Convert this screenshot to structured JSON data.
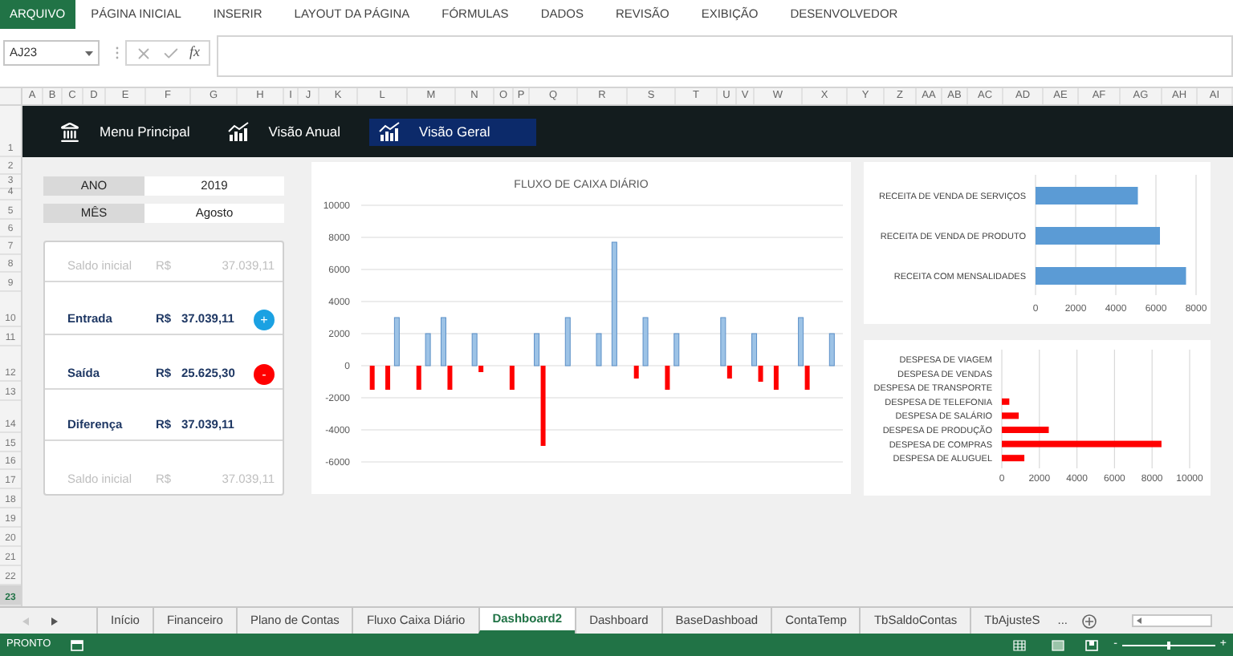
{
  "ribbon_tabs": [
    {
      "label": "ARQUIVO",
      "selected": true
    },
    {
      "label": "PÁGINA INICIAL",
      "selected": false
    },
    {
      "label": "INSERIR",
      "selected": false
    },
    {
      "label": "LAYOUT DA PÁGINA",
      "selected": false
    },
    {
      "label": "FÓRMULAS",
      "selected": false
    },
    {
      "label": "DADOS",
      "selected": false
    },
    {
      "label": "REVISÃO",
      "selected": false
    },
    {
      "label": "EXIBIÇÃO",
      "selected": false
    },
    {
      "label": "DESENVOLVEDOR",
      "selected": false
    }
  ],
  "name_box": {
    "value": "AJ23"
  },
  "formula_bar": {
    "fx_label": "fx"
  },
  "column_headers": [
    "A",
    "B",
    "C",
    "D",
    "E",
    "F",
    "G",
    "H",
    "I",
    "J",
    "K",
    "L",
    "M",
    "N",
    "O",
    "P",
    "Q",
    "R",
    "S",
    "T",
    "U",
    "V",
    "W",
    "X",
    "Y",
    "Z",
    "AA",
    "AB",
    "AC",
    "AD",
    "AE",
    "AF",
    "AG",
    "AH",
    "AI"
  ],
  "row_headers": [
    {
      "label": "1",
      "selected": false
    },
    {
      "label": "2",
      "selected": false
    },
    {
      "label": "3",
      "selected": false
    },
    {
      "label": "4",
      "selected": false
    },
    {
      "label": "5",
      "selected": false
    },
    {
      "label": "6",
      "selected": false
    },
    {
      "label": "7",
      "selected": false
    },
    {
      "label": "8",
      "selected": false
    },
    {
      "label": "9",
      "selected": false
    },
    {
      "label": "10",
      "selected": false
    },
    {
      "label": "11",
      "selected": false
    },
    {
      "label": "12",
      "selected": false
    },
    {
      "label": "13",
      "selected": false
    },
    {
      "label": "14",
      "selected": false
    },
    {
      "label": "15",
      "selected": false
    },
    {
      "label": "16",
      "selected": false
    },
    {
      "label": "17",
      "selected": false
    },
    {
      "label": "18",
      "selected": false
    },
    {
      "label": "19",
      "selected": false
    },
    {
      "label": "20",
      "selected": false
    },
    {
      "label": "21",
      "selected": false
    },
    {
      "label": "22",
      "selected": false
    },
    {
      "label": "23",
      "selected": true
    }
  ],
  "nav": [
    {
      "kind": "bank",
      "label": "Menu Principal",
      "selected": false
    },
    {
      "kind": "chart",
      "label": "Visão Anual",
      "selected": false
    },
    {
      "kind": "chart",
      "label": "Visão Geral",
      "selected": true
    }
  ],
  "filters": [
    {
      "label": "ANO",
      "value": "2019"
    },
    {
      "label": "MÊS",
      "value": "Agosto"
    }
  ],
  "summary": [
    {
      "kind": "faded",
      "label": "Saldo inicial",
      "currency": "R$",
      "value": "37.039,11"
    },
    {
      "kind": "main",
      "label": "Entrada",
      "currency": "R$",
      "value": "37.039,11",
      "action": {
        "symbol": "+",
        "color": "#1ba1e2"
      }
    },
    {
      "kind": "main",
      "label": "Saída",
      "currency": "R$",
      "value": "25.625,30",
      "action": {
        "symbol": "-",
        "color": "#ff0000"
      }
    },
    {
      "kind": "main",
      "label": "Diferença",
      "currency": "R$",
      "value": "37.039,11"
    },
    {
      "kind": "faded",
      "label": "Saldo inicial",
      "currency": "R$",
      "value": "37.039,11"
    }
  ],
  "cash_flow_chart": {
    "chart_data": {
      "type": "bar",
      "grid": true,
      "title": "FLUXO DE CAIXA DIÁRIO",
      "ylim": [
        -6000,
        10000
      ],
      "yticks": [
        10000,
        8000,
        6000,
        4000,
        2000,
        0,
        -2000,
        -4000,
        -6000
      ],
      "series": [
        {
          "color": "#9dc3e6",
          "values": [
            null,
            null,
            3000,
            null,
            2000,
            3000,
            null,
            2000,
            null,
            null,
            null,
            2000,
            null,
            3000,
            null,
            2000,
            7700,
            null,
            3000,
            null,
            2000,
            null,
            null,
            3000,
            null,
            2000,
            null,
            null,
            3000,
            null,
            2000
          ]
        },
        {
          "color": "#ff0000",
          "values": [
            -1500,
            -1500,
            null,
            -1500,
            null,
            -1500,
            null,
            -400,
            null,
            -1500,
            null,
            -5000,
            null,
            null,
            null,
            null,
            null,
            -800,
            null,
            -1500,
            null,
            null,
            null,
            -800,
            null,
            -1000,
            -1500,
            null,
            -1500,
            null,
            null
          ]
        }
      ]
    }
  },
  "revenue_chart": {
    "chart_data": {
      "type": "bar",
      "grid": true,
      "orientation": "horizontal",
      "categories": [
        "RECEITA DE VENDA DE SERVIÇOS",
        "RECEITA DE VENDA DE PRODUTO",
        "RECEITA COM MENSALIDADES"
      ],
      "series": [
        {
          "color": "#5b9bd5",
          "values": [
            5100,
            6200,
            7500
          ]
        }
      ],
      "xlim": [
        0,
        8000
      ],
      "xticks": [
        0,
        2000,
        4000,
        6000,
        8000
      ]
    }
  },
  "expense_chart": {
    "chart_data": {
      "type": "bar",
      "grid": true,
      "orientation": "horizontal",
      "categories": [
        "DESPESA DE VIAGEM",
        "DESPESA DE VENDAS",
        "DESPESA DE TRANSPORTE",
        "DESPESA DE TELEFONIA",
        "DESPESA DE SALÁRIO",
        "DESPESA DE PRODUÇÃO",
        "DESPESA DE COMPRAS",
        "DESPESA DE ALUGUEL"
      ],
      "series": [
        {
          "color": "#ff0000",
          "values": [
            0,
            0,
            0,
            400,
            900,
            2500,
            8500,
            1200
          ]
        }
      ],
      "xlim": [
        0,
        10000
      ],
      "xticks": [
        0,
        2000,
        4000,
        6000,
        8000,
        10000
      ]
    }
  },
  "sheet_tabs": [
    {
      "label": "Início",
      "selected": false
    },
    {
      "label": "Financeiro",
      "selected": false
    },
    {
      "label": "Plano de Contas",
      "selected": false
    },
    {
      "label": "Fluxo Caixa Diário",
      "selected": false
    },
    {
      "label": "Dashboard2",
      "selected": true
    },
    {
      "label": "Dashboard",
      "selected": false
    },
    {
      "label": "BaseDashboad",
      "selected": false
    },
    {
      "label": "ContaTemp",
      "selected": false
    },
    {
      "label": "TbSaldoContas",
      "selected": false
    },
    {
      "label": "TbAjusteS",
      "selected": false
    }
  ],
  "sheet_more": "...",
  "status_bar": {
    "status": "PRONTO",
    "zoom": {
      "minus": "-",
      "plus": "+",
      "level": 0.5
    }
  }
}
